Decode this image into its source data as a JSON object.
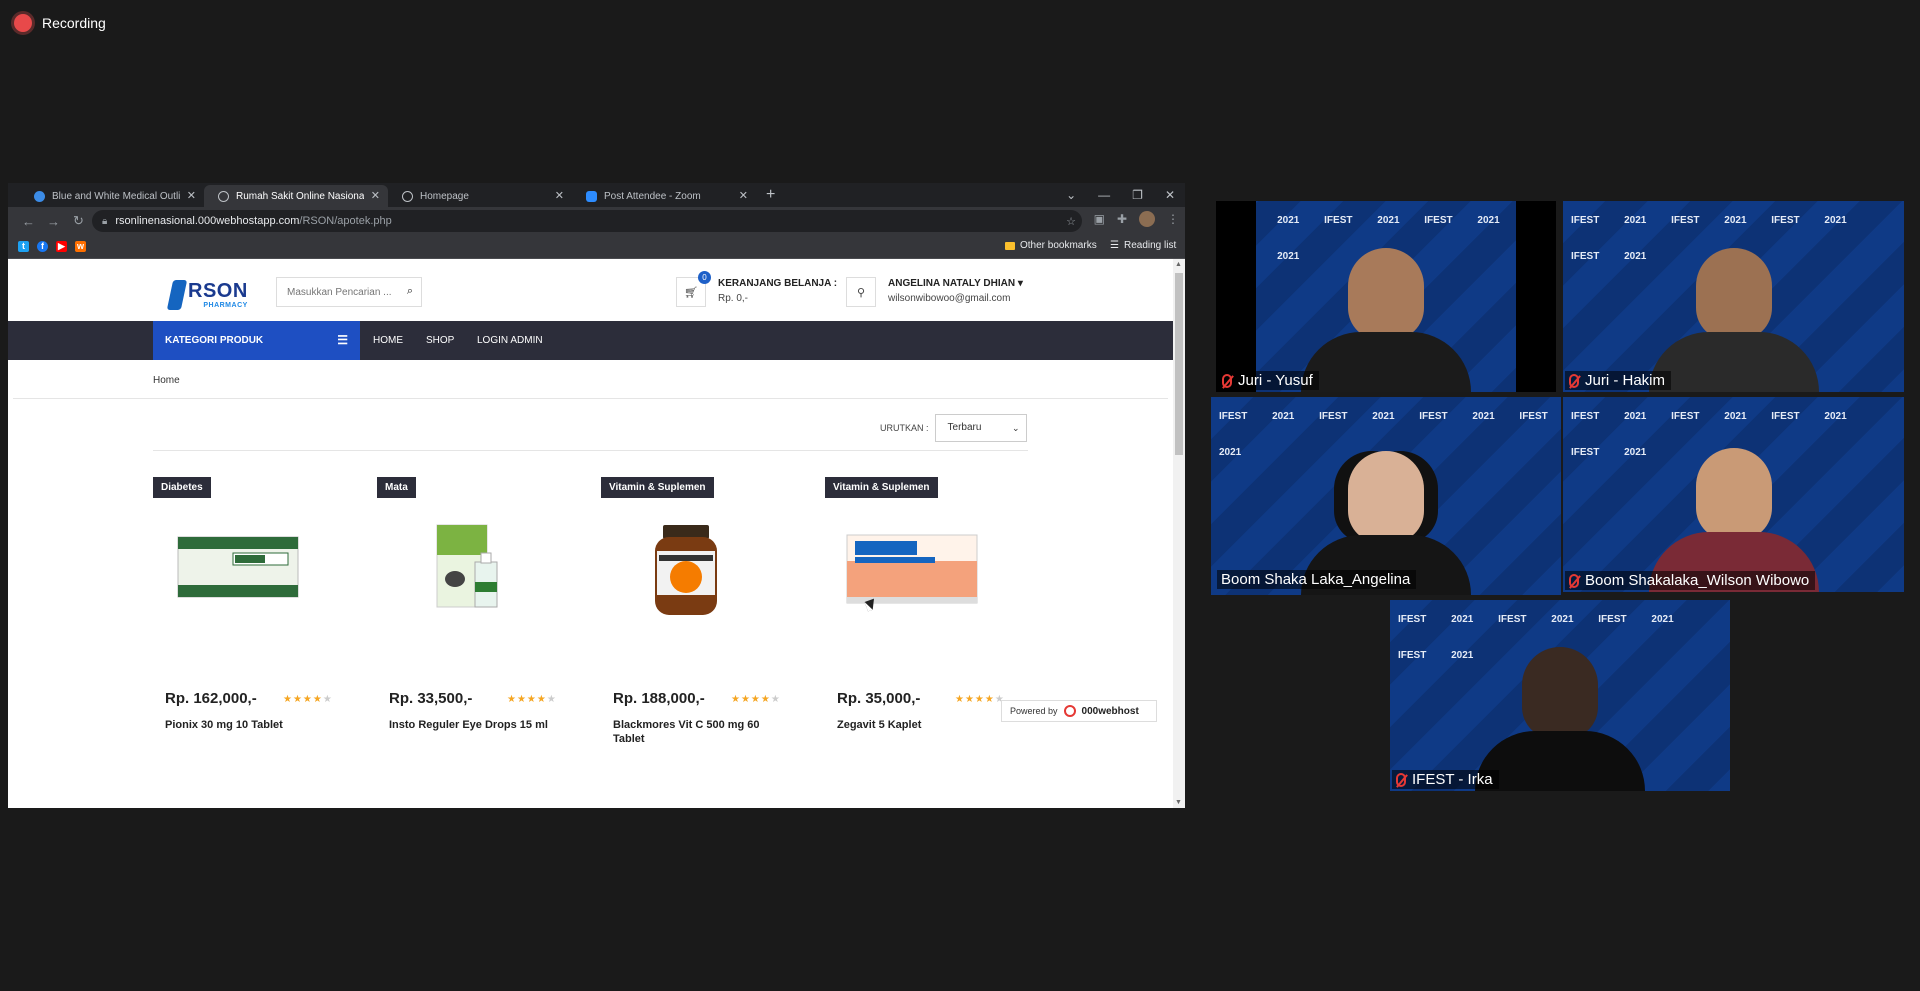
{
  "recording": {
    "label": "Recording"
  },
  "browser": {
    "tabs": [
      {
        "title": "Blue and White Medical Outline",
        "active": false,
        "favicon_color": "#3c8ce7"
      },
      {
        "title": "Rumah Sakit Online Nasional",
        "active": true,
        "favicon_color": "#9aa0a6"
      },
      {
        "title": "Homepage",
        "active": false,
        "favicon_color": "#9aa0a6"
      },
      {
        "title": "Post Attendee - Zoom",
        "active": false,
        "favicon_color": "#2d8cff"
      }
    ],
    "new_tab": "+",
    "url_domain": "rsonlinenasional.000webhostapp.com",
    "url_path": "/RSON/apotek.php",
    "bookmarks": {
      "other": "Other bookmarks",
      "reading_list": "Reading list"
    }
  },
  "site": {
    "logo": {
      "name": "RSON",
      "sub": "PHARMACY"
    },
    "search": {
      "placeholder": "Masukkan Pencarian ..."
    },
    "cart": {
      "title": "KERANJANG BELANJA :",
      "amount": "Rp. 0,-",
      "count": "0"
    },
    "user": {
      "name": "ANGELINA NATALY DHIAN",
      "email": "wilsonwibowoo@gmail.com"
    },
    "nav": {
      "category": "KATEGORI PRODUK",
      "links": [
        "HOME",
        "SHOP",
        "LOGIN ADMIN"
      ]
    },
    "breadcrumb": "Home",
    "sort": {
      "label": "URUTKAN :",
      "selected": "Terbaru"
    },
    "products": [
      {
        "category": "Diabetes",
        "price": "Rp. 162,000,-",
        "name": "Pionix 30 mg 10 Tablet",
        "rating": 4
      },
      {
        "category": "Mata",
        "price": "Rp. 33,500,-",
        "name": "Insto Reguler Eye Drops 15 ml",
        "rating": 4
      },
      {
        "category": "Vitamin & Suplemen",
        "price": "Rp. 188,000,-",
        "name": "Blackmores Vit C 500 mg 60 Tablet",
        "rating": 4
      },
      {
        "category": "Vitamin & Suplemen",
        "price": "Rp. 35,000,-",
        "name": "Zegavit 5 Kaplet",
        "rating": 4
      }
    ],
    "powered": {
      "label": "Powered by",
      "brand": "000webhost"
    }
  },
  "participants": [
    {
      "name": "Juri - Yusuf",
      "muted": true,
      "speaking": false
    },
    {
      "name": "Juri - Hakim",
      "muted": true,
      "speaking": false
    },
    {
      "name": "Boom Shaka Laka_Angelina",
      "muted": false,
      "speaking": true
    },
    {
      "name": "Boom Shakalaka_Wilson Wibowo",
      "muted": true,
      "speaking": false
    },
    {
      "name": "IFEST - Irka",
      "muted": true,
      "speaking": false
    }
  ],
  "tile_watermark": "IFEST 2021",
  "colors": {
    "accent": "#1e4fc2",
    "navbar": "#2c2d3a",
    "highlight": "#e6f04a"
  }
}
